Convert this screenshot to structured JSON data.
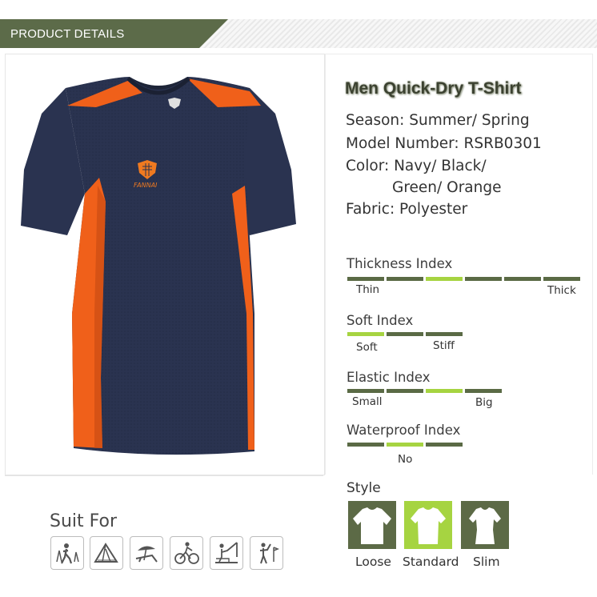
{
  "header": {
    "label": "PRODUCT DETAILS"
  },
  "product": {
    "title": "Men Quick-Dry T-Shirt",
    "season": "Season: Summer/ Spring",
    "model": "Model Number: RSRB0301",
    "color_line1": "Color: Navy/ Black/",
    "color_line2": "Green/ Orange",
    "fabric": "Fabric: Polyester",
    "logo_text": "FANNAI"
  },
  "indices": {
    "thickness": {
      "title": "Thickness Index",
      "low": "Thin",
      "high": "Thick",
      "segments": 6,
      "selected": 3
    },
    "soft": {
      "title": "Soft Index",
      "low": "Soft",
      "high": "Stiff",
      "segments": 3,
      "selected": 1
    },
    "elastic": {
      "title": "Elastic Index",
      "low": "Small",
      "high": "Big",
      "segments": 4,
      "selected": 3
    },
    "waterproof": {
      "title": "Waterproof Index",
      "value": "No",
      "segments": 3,
      "selected": 2
    }
  },
  "style": {
    "title": "Style",
    "options": [
      {
        "label": "Loose",
        "selected": false
      },
      {
        "label": "Standard",
        "selected": true
      },
      {
        "label": "Slim",
        "selected": false
      }
    ]
  },
  "suit_for": {
    "title": "Suit For",
    "icons": [
      "hiking-icon",
      "camping-tent-icon",
      "beach-lounge-icon",
      "cycling-icon",
      "fishing-icon",
      "golf-icon"
    ]
  },
  "colors": {
    "accent_green": "#a6d441",
    "dark_green": "#5a6a45",
    "navy": "#2a3350",
    "orange": "#f0601a"
  }
}
